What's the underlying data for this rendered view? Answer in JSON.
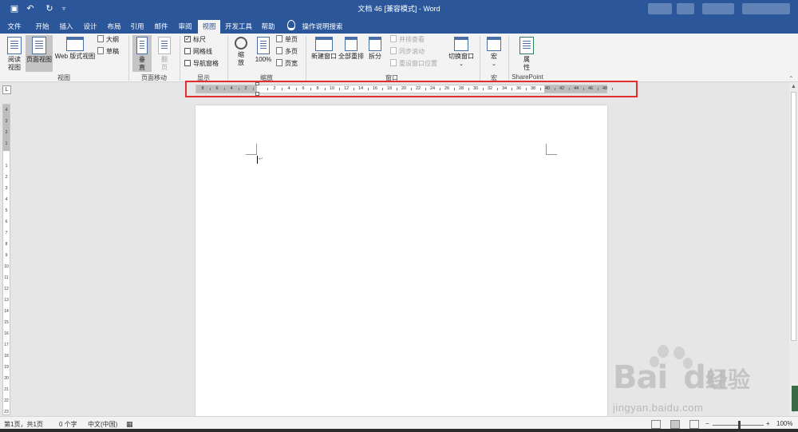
{
  "title_bar": {
    "title": "文档 46 [兼容模式] - Word",
    "quick_access": [
      "save-icon",
      "undo-icon",
      "redo-icon",
      "customize-icon"
    ],
    "share_label": "共享"
  },
  "menu_tabs": [
    {
      "label": "文件"
    },
    {
      "label": "开始"
    },
    {
      "label": "插入"
    },
    {
      "label": "设计"
    },
    {
      "label": "布局"
    },
    {
      "label": "引用"
    },
    {
      "label": "邮件"
    },
    {
      "label": "审阅"
    },
    {
      "label": "视图",
      "active": true
    },
    {
      "label": "开发工具"
    },
    {
      "label": "帮助"
    }
  ],
  "tell_me": "操作说明搜索",
  "ribbon": {
    "views": {
      "read_mode": "阅读视图",
      "print_layout": "页面视图",
      "web_layout": "Web 版式视图",
      "outline": "大纲",
      "draft": "草稿",
      "group_label": "视图"
    },
    "page_movement": {
      "vertical": "垂直",
      "side_to_side": "翻页",
      "group_label": "页面移动"
    },
    "show": {
      "ruler": "标尺",
      "gridlines": "网格线",
      "nav_pane": "导航窗格",
      "group_label": "显示",
      "ruler_checked": true,
      "gridlines_checked": false,
      "nav_pane_checked": false
    },
    "zoom": {
      "zoom": "缩放",
      "hundred": "100%",
      "one_page": "单页",
      "multiple_pages": "多页",
      "page_width": "页宽",
      "group_label": "缩放"
    },
    "window": {
      "new_window": "新建窗口",
      "arrange_all": "全部重排",
      "split": "拆分",
      "side_by_side": "并排查看",
      "sync_scroll": "同步滚动",
      "reset_position": "重设窗口位置",
      "switch_windows": "切换窗口",
      "group_label": "窗口"
    },
    "macros": {
      "macros": "宏",
      "group_label": "宏"
    },
    "sharepoint": {
      "properties": "属性",
      "group_label": "SharePoint"
    }
  },
  "ruler": {
    "corner_label": "L",
    "labels": [
      "8",
      "6",
      "4",
      "2",
      "",
      "2",
      "4",
      "6",
      "8",
      "10",
      "12",
      "14",
      "16",
      "18",
      "20",
      "22",
      "24",
      "26",
      "28",
      "30",
      "32",
      "34",
      "36",
      "38",
      "40",
      "42",
      "44",
      "46",
      "48"
    ],
    "vertical_labels": [
      "4",
      "3",
      "2",
      "1",
      "",
      "1",
      "2",
      "3",
      "4",
      "5",
      "6",
      "7",
      "8",
      "9",
      "10",
      "11",
      "12",
      "13",
      "14",
      "15",
      "16",
      "17",
      "18",
      "19",
      "20",
      "21",
      "22",
      "23",
      "24"
    ]
  },
  "status_bar": {
    "page": "第1页，共1页",
    "words": "0 个字",
    "language": "中文(中国)",
    "zoom": "100%"
  },
  "watermark": {
    "brand": "Bai",
    "brand2": "du",
    "cn": "经验",
    "url": "jingyan.baidu.com"
  },
  "colors": {
    "brand_blue": "#2b579a",
    "highlight_red": "#e02d2d"
  }
}
